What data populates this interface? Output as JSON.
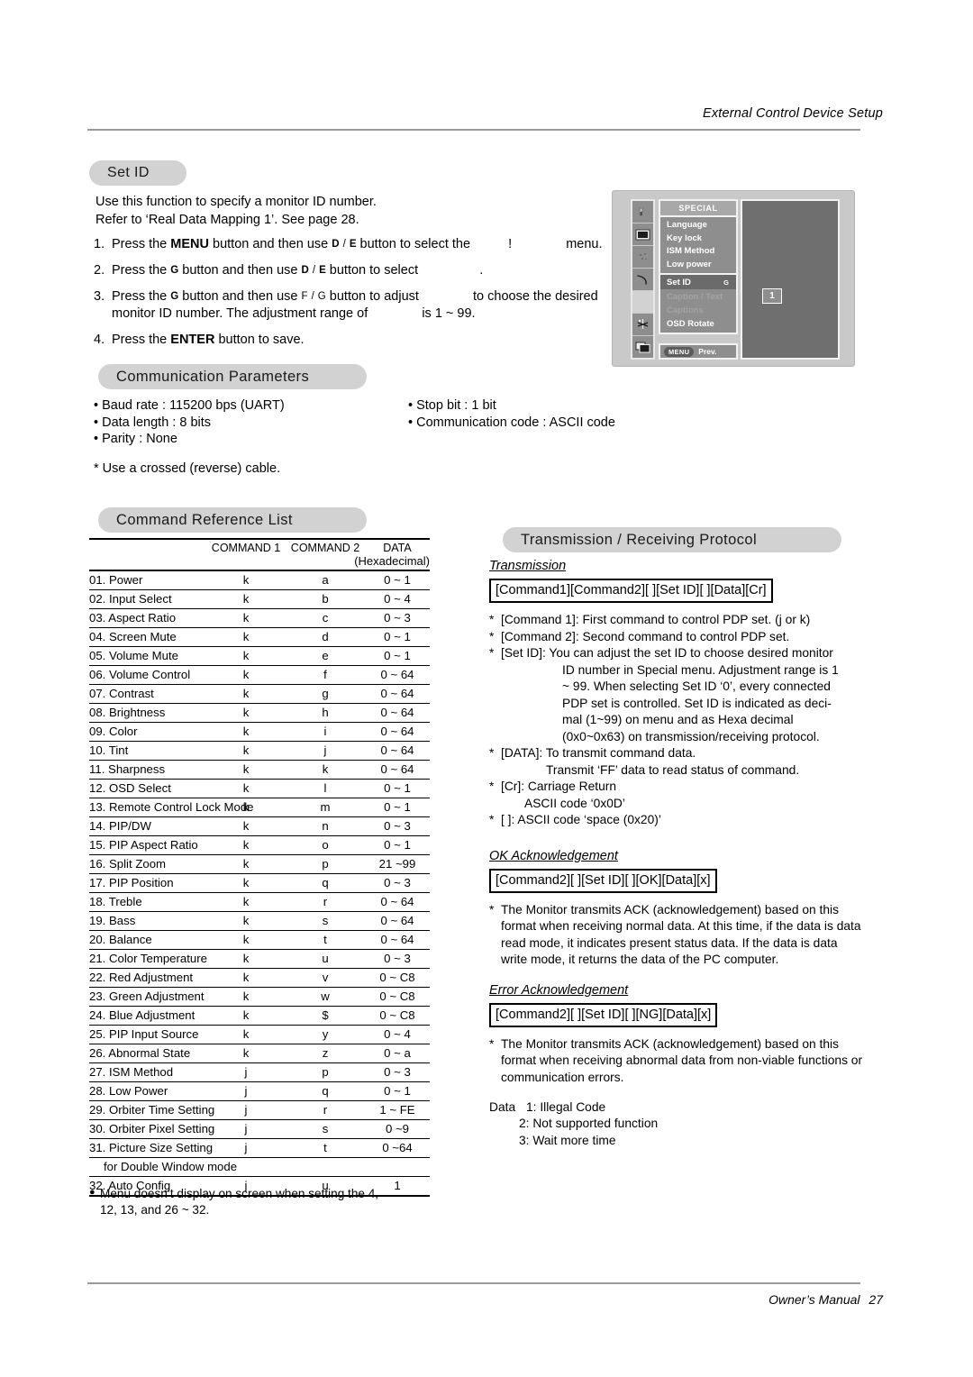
{
  "header": {
    "running_head": "External Control Device Setup"
  },
  "footer": {
    "manual_label": "Owner’s Manual",
    "page_number": "27"
  },
  "setid": {
    "pill_label": "Set ID",
    "intro_line1": "Use this function to specify a monitor ID number.",
    "intro_line2": "Refer to ‘Real Data Mapping 1’. See page 28.",
    "steps": [
      {
        "num": "1.",
        "a": "Press the",
        "kbd1": "MENU",
        "b": "button and then use",
        "g1": "D",
        "slash": "/",
        "g2": "E",
        "c": "button to select the",
        "missing": "!",
        "d": "menu."
      },
      {
        "num": "2.",
        "a": "Press the",
        "kbd1": "G",
        "b": "button and then use",
        "g1": "D",
        "slash": "/",
        "g2": "E",
        "c": "button to select",
        "d": "."
      },
      {
        "num": "3.",
        "a": "Press the",
        "kbd1": "G",
        "b": "button and then use",
        "g1": "F",
        "slash": "/",
        "g2": "G",
        "c": "button to adjust",
        "d": "to choose the desired",
        "line2a": "monitor ID number. The adjustment range of",
        "line2b": "is 1 ~ 99."
      },
      {
        "num": "4.",
        "a": "Press the",
        "kbd1": "ENTER",
        "b": "button to save."
      }
    ]
  },
  "osd": {
    "title": "SPECIAL",
    "items_top": [
      "Language",
      "Key lock",
      "ISM Method",
      "Low power"
    ],
    "selected_item": {
      "label": "Set ID",
      "arrow": "G"
    },
    "items_bottom": [
      {
        "label": "Caption / Text",
        "dim": true
      },
      {
        "label": "Captions",
        "dim": true
      },
      {
        "label": "OSD Rotate",
        "dim": false
      }
    ],
    "menu_button": "MENU",
    "prev_label": "Prev.",
    "value": "1",
    "icons": [
      "picture-icon",
      "screen-icon",
      "sound-icon",
      "time-icon",
      "special-icon",
      "arrange-icon",
      "pip-icon"
    ]
  },
  "communication": {
    "pill_label": "Communication Parameters",
    "left": [
      "• Baud rate : 115200 bps (UART)",
      "• Data length : 8 bits",
      "• Parity : None"
    ],
    "right": [
      "• Stop bit : 1 bit",
      "• Communication code : ASCII code"
    ],
    "note": "* Use a crossed (reverse) cable."
  },
  "command_list": {
    "pill_label": "Command Reference List",
    "headers": {
      "name": "",
      "command1": "COMMAND 1",
      "command2": "COMMAND 2",
      "data": "DATA",
      "data_sub": "(Hexadecimal)"
    },
    "rows": [
      {
        "name": "01. Power",
        "c1": "k",
        "c2": "a",
        "data": "0 ~ 1"
      },
      {
        "name": "02. Input Select",
        "c1": "k",
        "c2": "b",
        "data": "0 ~ 4"
      },
      {
        "name": "03. Aspect Ratio",
        "c1": "k",
        "c2": "c",
        "data": "0 ~ 3"
      },
      {
        "name": "04. Screen Mute",
        "c1": "k",
        "c2": "d",
        "data": "0 ~ 1"
      },
      {
        "name": "05. Volume Mute",
        "c1": "k",
        "c2": "e",
        "data": "0 ~ 1"
      },
      {
        "name": "06. Volume Control",
        "c1": "k",
        "c2": "f",
        "data": "0 ~ 64"
      },
      {
        "name": "07. Contrast",
        "c1": "k",
        "c2": "g",
        "data": "0 ~ 64"
      },
      {
        "name": "08. Brightness",
        "c1": "k",
        "c2": "h",
        "data": "0 ~ 64"
      },
      {
        "name": "09. Color",
        "c1": "k",
        "c2": "i",
        "data": "0 ~ 64"
      },
      {
        "name": "10. Tint",
        "c1": "k",
        "c2": "j",
        "data": "0 ~ 64"
      },
      {
        "name": "11. Sharpness",
        "c1": "k",
        "c2": "k",
        "data": "0 ~ 64"
      },
      {
        "name": "12. OSD Select",
        "c1": "k",
        "c2": "l",
        "data": "0 ~ 1"
      },
      {
        "name": "13. Remote Control Lock Mode",
        "c1": "k",
        "c2": "m",
        "data": "0 ~ 1"
      },
      {
        "name": "14. PIP/DW",
        "c1": "k",
        "c2": "n",
        "data": "0 ~ 3"
      },
      {
        "name": "15. PIP Aspect Ratio",
        "c1": "k",
        "c2": "o",
        "data": "0 ~ 1"
      },
      {
        "name": "16. Split Zoom",
        "c1": "k",
        "c2": "p",
        "data": "21 ~99"
      },
      {
        "name": "17. PIP Position",
        "c1": "k",
        "c2": "q",
        "data": "0 ~ 3"
      },
      {
        "name": "18. Treble",
        "c1": "k",
        "c2": "r",
        "data": "0 ~ 64"
      },
      {
        "name": "19. Bass",
        "c1": "k",
        "c2": "s",
        "data": "0 ~ 64"
      },
      {
        "name": "20. Balance",
        "c1": "k",
        "c2": "t",
        "data": "0 ~ 64"
      },
      {
        "name": "21. Color Temperature",
        "c1": "k",
        "c2": "u",
        "data": "0 ~ 3"
      },
      {
        "name": "22. Red Adjustment",
        "c1": "k",
        "c2": "v",
        "data": "0 ~ C8"
      },
      {
        "name": "23. Green Adjustment",
        "c1": "k",
        "c2": "w",
        "data": "0 ~ C8"
      },
      {
        "name": "24. Blue Adjustment",
        "c1": "k",
        "c2": "$",
        "data": "0 ~ C8"
      },
      {
        "name": "25. PIP Input Source",
        "c1": "k",
        "c2": "y",
        "data": "0 ~ 4"
      },
      {
        "name": "26. Abnormal State",
        "c1": "k",
        "c2": "z",
        "data": "0 ~ a"
      },
      {
        "name": "27. ISM Method",
        "c1": "j",
        "c2": "p",
        "data": "0 ~ 3"
      },
      {
        "name": "28. Low Power",
        "c1": "j",
        "c2": "q",
        "data": "0 ~ 1"
      },
      {
        "name": "29. Orbiter Time Setting",
        "c1": "j",
        "c2": "r",
        "data": "1 ~ FE"
      },
      {
        "name": "30. Orbiter Pixel Setting",
        "c1": "j",
        "c2": "s",
        "data": "0 ~9"
      },
      {
        "name": "31. Picture Size Setting",
        "c1": "j",
        "c2": "t",
        "data": "0 ~64"
      },
      {
        "name": "for Double Window mode",
        "c1": "",
        "c2": "",
        "data": "",
        "continuation": true
      },
      {
        "name": "32. Auto Config",
        "c1": "j",
        "c2": "u",
        "data": "1"
      }
    ],
    "note_line1": "Menu doesn’t display on screen when setting the 4,",
    "note_line2": "12, 13, and 26 ~ 32."
  },
  "protocol": {
    "pill_label": "Transmission / Receiving  Protocol",
    "transmission": {
      "heading": "Transmission",
      "format": "[Command1][Command2][  ][Set ID][  ][Data][Cr]",
      "items": [
        "[Command 1]: First command to control PDP set. (j or k)",
        "[Command 2]: Second command to control PDP set."
      ],
      "setid_label": "[Set ID]: You can adjust the set ID to choose desired monitor",
      "setid_lines": [
        "ID number in Special menu. Adjustment range is 1",
        "~ 99. When selecting Set ID ‘0’, every connected",
        "PDP set is controlled. Set ID is indicated as deci-",
        "mal (1~99) on menu and as Hexa decimal",
        "(0x0~0x63) on transmission/receiving protocol."
      ],
      "data_label": "[DATA]: To transmit command data.",
      "data_line2": "Transmit ‘FF’ data to read status of command.",
      "cr_label": "[Cr]: Carriage Return",
      "cr_line2": "ASCII code ‘0x0D’",
      "space_label": "[   ]: ASCII code ‘space (0x20)’"
    },
    "ok_ack": {
      "heading": "OK Acknowledgement",
      "format": "[Command2][  ][Set ID][  ][OK][Data][x]",
      "paragraph": "The Monitor transmits ACK (acknowledgement) based on this format when receiving normal data. At this time, if the data is data read mode, it indicates present status data. If the data is data write mode, it returns the data of the PC computer."
    },
    "error_ack": {
      "heading": "Error Acknowledgement",
      "format": "[Command2][  ][Set ID][  ][NG][Data][x]",
      "paragraph": "The Monitor transmits ACK (acknowledgement) based on this format when receiving abnormal data from non-viable functions or communication errors.",
      "data_label": "Data",
      "data_values": [
        "1: Illegal Code",
        "2: Not supported function",
        "3: Wait more time"
      ]
    }
  }
}
